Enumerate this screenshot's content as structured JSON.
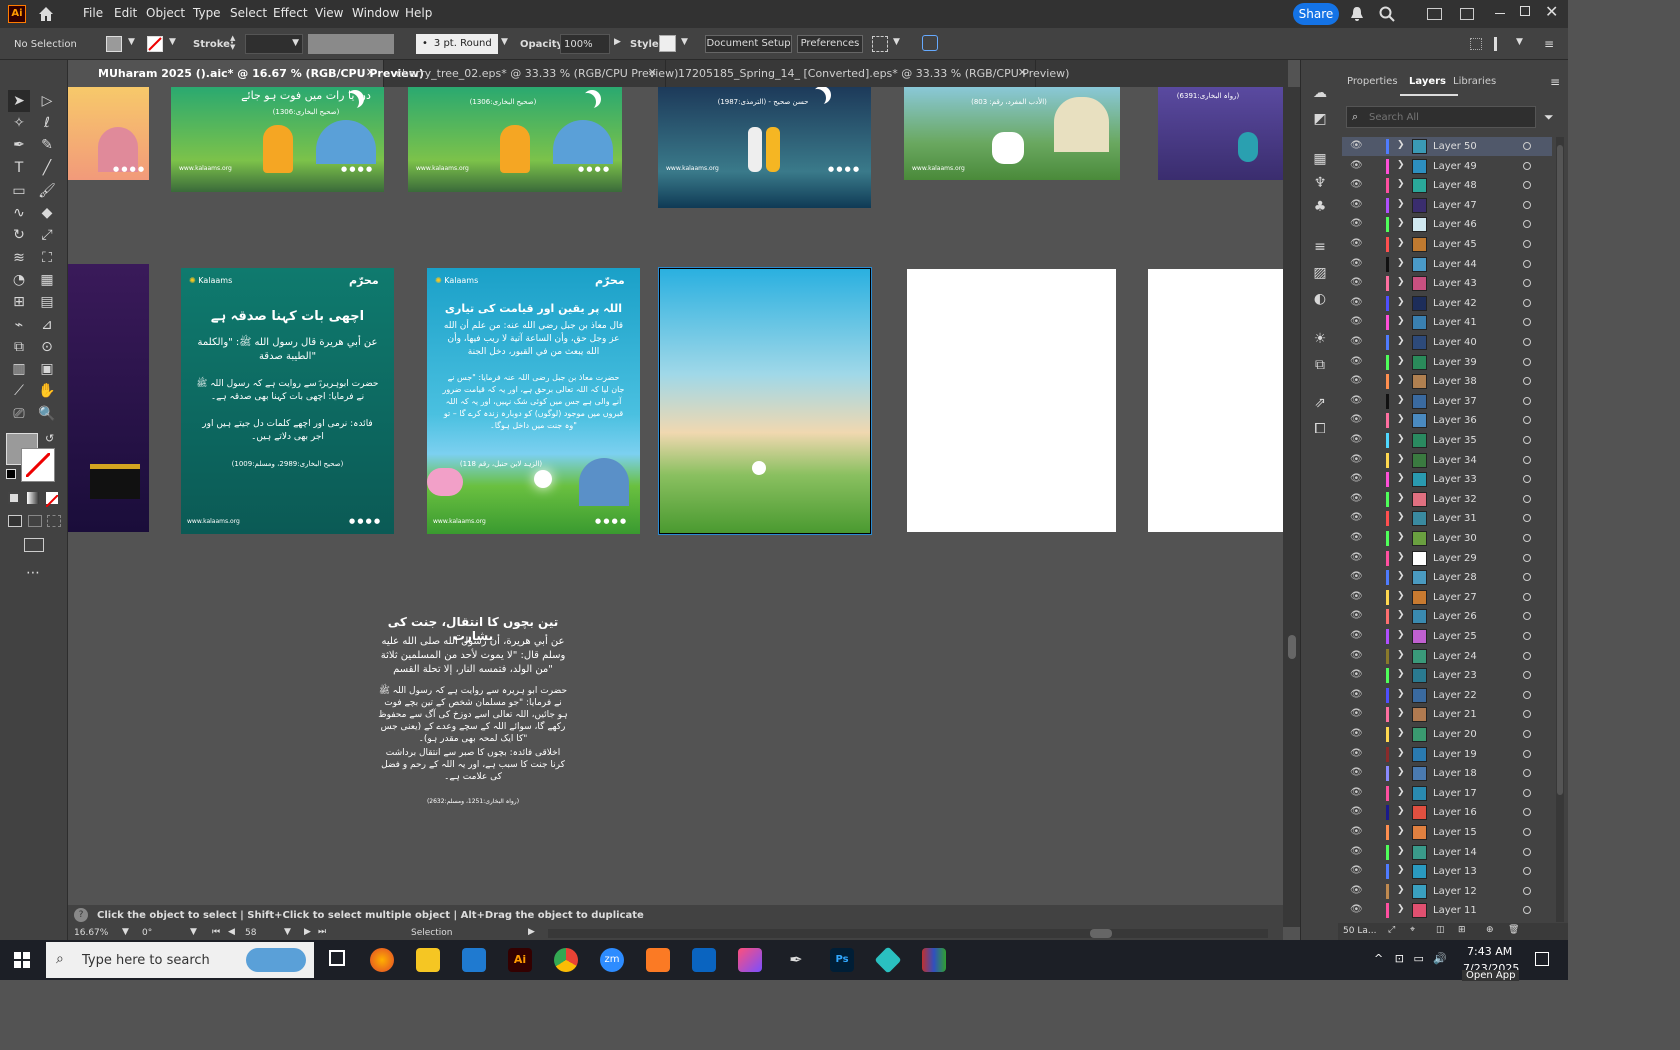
{
  "app": {
    "logo": "Ai",
    "menus": [
      "File",
      "Edit",
      "Object",
      "Type",
      "Select",
      "Effect",
      "View",
      "Window",
      "Help"
    ],
    "share_label": "Share"
  },
  "control": {
    "selection": "No Selection",
    "stroke_label": "Stroke:",
    "brush": "3 pt. Round",
    "opacity_label": "Opacity:",
    "opacity_value": "100%",
    "style_label": "Style:",
    "doc_setup": "Document Setup",
    "preferences": "Preferences"
  },
  "tabs": [
    {
      "label": "MUharam 2025 ().aic* @ 16.67 % (RGB/CPU Preview)"
    },
    {
      "label": "cherry_tree_02.eps* @ 33.33 % (RGB/CPU Preview)"
    },
    {
      "label": "17205185_Spring_14_ [Converted].eps* @ 33.33 % (RGB/CPU Preview)"
    }
  ],
  "panel": {
    "tabs": [
      "Properties",
      "Layers",
      "Libraries"
    ],
    "search_placeholder": "Search All",
    "footer_count": "50 La..."
  },
  "layers": [
    {
      "name": "Layer 50",
      "color": "#4f7cff",
      "thumb": "#3a9ab5"
    },
    {
      "name": "Layer 49",
      "color": "#ff4fd8",
      "thumb": "#2d8fc0"
    },
    {
      "name": "Layer 48",
      "color": "#ff4fa0",
      "thumb": "#2aa89a"
    },
    {
      "name": "Layer 47",
      "color": "#b04fff",
      "thumb": "#3a2d6e"
    },
    {
      "name": "Layer 46",
      "color": "#4fff5a",
      "thumb": "#d0e8f0"
    },
    {
      "name": "Layer 45",
      "color": "#ff4f4f",
      "thumb": "#c07a30"
    },
    {
      "name": "Layer 44",
      "color": "#111111",
      "thumb": "#4a9ac8"
    },
    {
      "name": "Layer 43",
      "color": "#ff6fa0",
      "thumb": "#c85080"
    },
    {
      "name": "Layer 42",
      "color": "#4f4fff",
      "thumb": "#1d2d5a"
    },
    {
      "name": "Layer 41",
      "color": "#ff4fd8",
      "thumb": "#3a80b0"
    },
    {
      "name": "Layer 40",
      "color": "#4f7cff",
      "thumb": "#2d4a7a"
    },
    {
      "name": "Layer 39",
      "color": "#4fff5a",
      "thumb": "#2a8a5a"
    },
    {
      "name": "Layer 38",
      "color": "#ff8f4f",
      "thumb": "#b08050"
    },
    {
      "name": "Layer 37",
      "color": "#111111",
      "thumb": "#3a6aa0"
    },
    {
      "name": "Layer 36",
      "color": "#ff6fa0",
      "thumb": "#4a8ac0"
    },
    {
      "name": "Layer 35",
      "color": "#4fd8ff",
      "thumb": "#2a8a60"
    },
    {
      "name": "Layer 34",
      "color": "#ffd84f",
      "thumb": "#3a7a40"
    },
    {
      "name": "Layer 33",
      "color": "#ff4fd8",
      "thumb": "#2a9ab0"
    },
    {
      "name": "Layer 32",
      "color": "#4fff5a",
      "thumb": "#e07080"
    },
    {
      "name": "Layer 31",
      "color": "#ff4f4f",
      "thumb": "#3a8aa0"
    },
    {
      "name": "Layer 30",
      "color": "#4fff5a",
      "thumb": "#6aa040"
    },
    {
      "name": "Layer 29",
      "color": "#ff4fa0",
      "thumb": "#ffffff"
    },
    {
      "name": "Layer 28",
      "color": "#4f7cff",
      "thumb": "#4a9ac0"
    },
    {
      "name": "Layer 27",
      "color": "#ffd84f",
      "thumb": "#c87a30"
    },
    {
      "name": "Layer 26",
      "color": "#ff6f6f",
      "thumb": "#3a8ab0"
    },
    {
      "name": "Layer 25",
      "color": "#b04fff",
      "thumb": "#c060d0"
    },
    {
      "name": "Layer 24",
      "color": "#8a7a2a",
      "thumb": "#3a9a7a"
    },
    {
      "name": "Layer 23",
      "color": "#4fff5a",
      "thumb": "#2a7a90"
    },
    {
      "name": "Layer 22",
      "color": "#4f4fff",
      "thumb": "#3a6aa0"
    },
    {
      "name": "Layer 21",
      "color": "#ff6fa0",
      "thumb": "#b07a50"
    },
    {
      "name": "Layer 20",
      "color": "#ffd84f",
      "thumb": "#3a9a70"
    },
    {
      "name": "Layer 19",
      "color": "#8a2a2a",
      "thumb": "#2a7ab0"
    },
    {
      "name": "Layer 18",
      "color": "#8a8aff",
      "thumb": "#4a7ab0"
    },
    {
      "name": "Layer 17",
      "color": "#ff4fa0",
      "thumb": "#2a8ab0"
    },
    {
      "name": "Layer 16",
      "color": "#1a1a8a",
      "thumb": "#e05040"
    },
    {
      "name": "Layer 15",
      "color": "#ff8f4f",
      "thumb": "#e08040"
    },
    {
      "name": "Layer 14",
      "color": "#4fff5a",
      "thumb": "#3a9a8a"
    },
    {
      "name": "Layer 13",
      "color": "#4f7cff",
      "thumb": "#2a9ac0"
    },
    {
      "name": "Layer 12",
      "color": "#c08a4f",
      "thumb": "#3aa0c0"
    },
    {
      "name": "Layer 11",
      "color": "#ff4fa0",
      "thumb": "#e05070"
    }
  ],
  "status": {
    "hint": "Click the object to select  |  Shift+Click to select multiple object  |  Alt+Drag the object to duplicate",
    "zoom": "16.67%",
    "angle": "0°",
    "artboard": "58",
    "tool": "Selection"
  },
  "artboards": {
    "brand": "Kalaams",
    "site": "www.kalaams.org",
    "a1_title": "اچھی بات کہنا صدقہ ہے",
    "a1_arabic": "عن أبي هريرة قال رسول الله ﷺ: \"والكلمة الطيبة صدقة\"",
    "a1_urdu": "حضرت ابوہریرہؓ سے روایت ہے کہ رسول اللہ ﷺ نے فرمایا: اچھی بات کہنا بھی صدقہ ہے۔",
    "a1_note": "فائدہ: نرمی اور اچھے کلمات دل جیتے ہیں اور اجر بھی دلاتے ہیں۔",
    "a1_ref": "(صحیح البخاری:2989، ومسلم:1009)",
    "a2_title": "اللہ پر یقین اور قیامت کی تیاری",
    "a2_arabic": "قال معاذ بن جبل رضي الله عنه: من علم أن الله عز وجل حق، وأن الساعة آتية لا ريب فيها، وأن الله يبعث من في القبور، دخل الجنة",
    "a2_urdu": "حضرت معاذ بن جبل رضی اللہ عنہ فرمایا: \"جس نے جان لیا کہ اللہ تعالی برحق ہے، اور یہ کہ قیامت ضرور آنے والی ہے جس میں کوئی شک نہیں، اور یہ کہ اللہ قبروں میں موجود (لوگوں) کو دوبارہ زندہ کرے گا – تو وہ جنت میں داخل ہوگا۔\"",
    "a2_ref": "(الزہد لابن حنبل، رقم 118)",
    "free_title": "تین بچوں کا انتقال، جنت کی بشارت",
    "free_arabic": "عن أبي هريرة، أن رسول الله صلى الله عليه وسلم قال: \"لا يموت لأحد من المسلمين ثلاثة من الولد، فتمسه النار، إلا تحلة القسم\"",
    "free_urdu": "حضرت ابو ہریرہ سے روایت ہے کہ رسول اللہ ﷺ نے فرمایا: \"جو مسلمان شخص کے تین بچے فوت ہو جائیں، اللہ تعالی اسے دوزخ کی آگ سے محفوظ رکھے گا، سوائے اللہ کے سچے وعدے کے (یعنی جس کا ایک لمحہ بھی مقدر ہو)۔\"",
    "free_note": "اخلاقی فائدہ: بچوں کا صبر سے انتقال برداشت کرنا جنت کا سبب ہے، اور یہ اللہ کے رحم و فضل کی علامت ہے۔",
    "free_ref": "(رواہ البخاری:1251، ومسلم:2632)",
    "top2_text": "دن یا رات میں فوت ہو جائے",
    "top2_ref": "(صحیح البخاری:1306)",
    "top3_ref": "(صحیح البخاری:1306)",
    "top4_ref": "(الترمذی:1987) - حسن صحیح",
    "top5_ref": "(الأدب المفرد، رقم: 803)",
    "top6_ref": "(رواہ البخاری:6391)"
  },
  "taskbar": {
    "search_placeholder": "Type here to search",
    "time": "7:43 AM",
    "date": "7/23/2025",
    "open_app": "Open App"
  }
}
